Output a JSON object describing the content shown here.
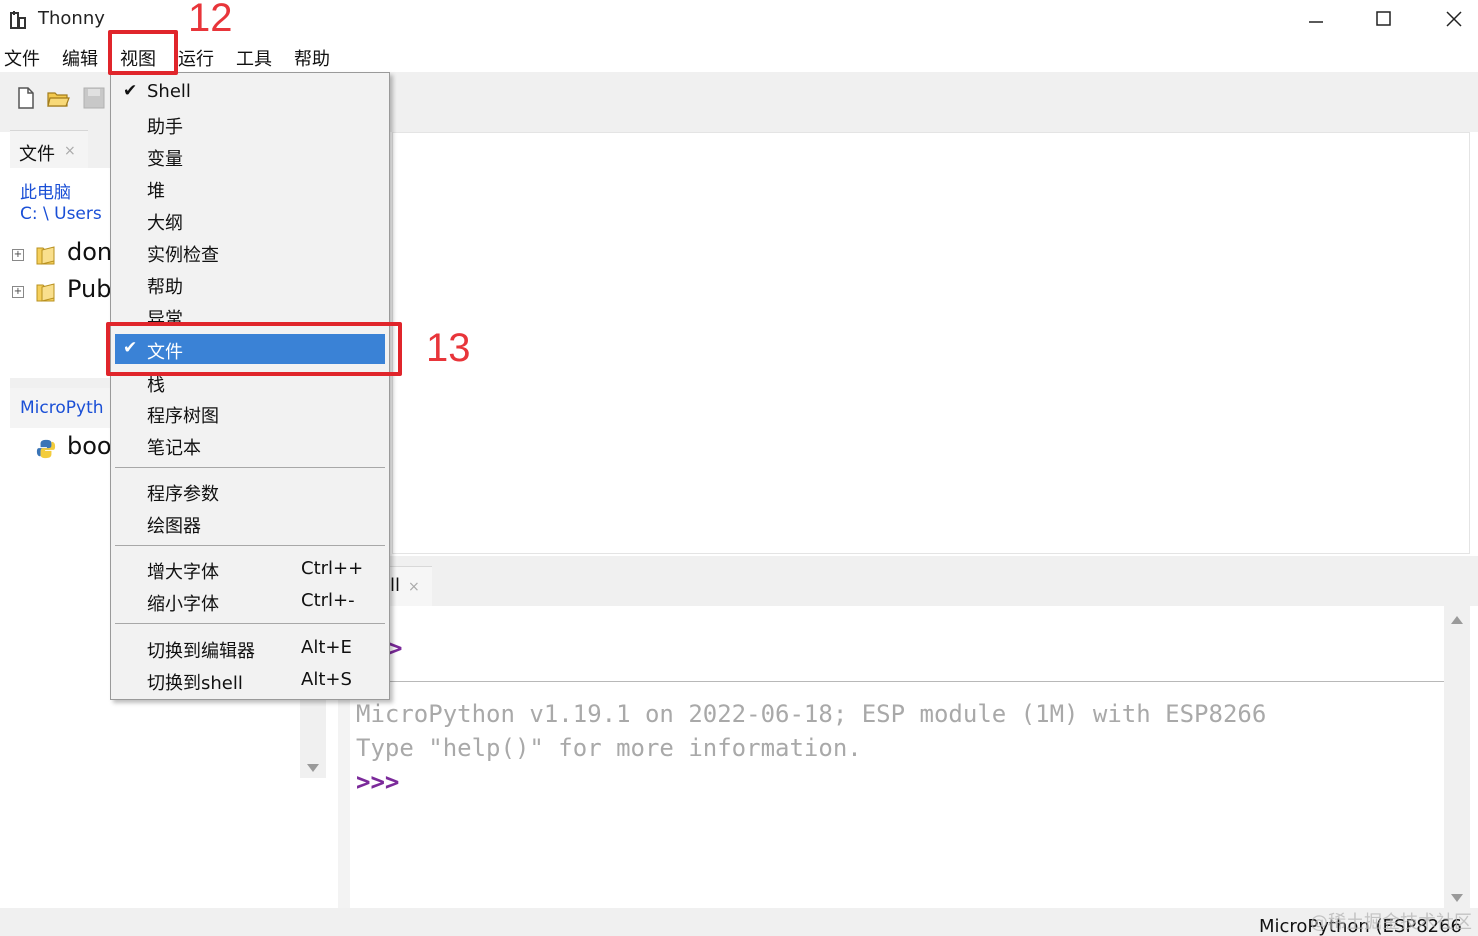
{
  "window": {
    "title": "Thonny"
  },
  "menubar": {
    "items": [
      "文件",
      "编辑",
      "视图",
      "运行",
      "工具",
      "帮助"
    ]
  },
  "files_panel": {
    "tab_label": "文件",
    "location_root": "此电脑",
    "location_path": "C: \\ Users",
    "folders": [
      "don",
      "Pub"
    ],
    "micropython_label": "MicroPyth",
    "device_files": [
      "boo"
    ]
  },
  "view_menu": {
    "items": [
      {
        "label": "Shell",
        "checked": true
      },
      {
        "label": "助手",
        "checked": false
      },
      {
        "label": "变量",
        "checked": false
      },
      {
        "label": "堆",
        "checked": false
      },
      {
        "label": "大纲",
        "checked": false
      },
      {
        "label": "实例检查",
        "checked": false
      },
      {
        "label": "帮助",
        "checked": false
      },
      {
        "label": "异常",
        "checked": false
      },
      {
        "label": "文件",
        "checked": true
      },
      {
        "label": "栈",
        "checked": false
      },
      {
        "label": "程序树图",
        "checked": false
      },
      {
        "label": "笔记本",
        "checked": false
      }
    ],
    "extra_items": [
      "程序参数",
      "绘图器"
    ],
    "font_items": [
      {
        "label": "增大字体",
        "shortcut": "Ctrl++"
      },
      {
        "label": "缩小字体",
        "shortcut": "Ctrl+-"
      }
    ],
    "switch_items": [
      {
        "label": "切换到编辑器",
        "shortcut": "Alt+E"
      },
      {
        "label": "切换到shell",
        "shortcut": "Alt+S"
      }
    ],
    "check_mark": "✔"
  },
  "shell": {
    "tab_label_fragment": "ll",
    "prev_prompt": ">",
    "line1": "MicroPython v1.19.1 on 2022-06-18; ESP module (1M) with ESP8266",
    "line2": "Type \"help()\" for more information.",
    "prompt": ">>>"
  },
  "statusbar": {
    "interpreter": "MicroPython (ESP8266",
    "watermark": "@稀土掘金技术社区"
  },
  "annotations": {
    "step_12": "12",
    "step_13": "13",
    "color": "#e0252b"
  },
  "colors": {
    "highlight": "#3a82d6",
    "link": "#1a4fd6",
    "prompt": "#7b2a9a"
  }
}
